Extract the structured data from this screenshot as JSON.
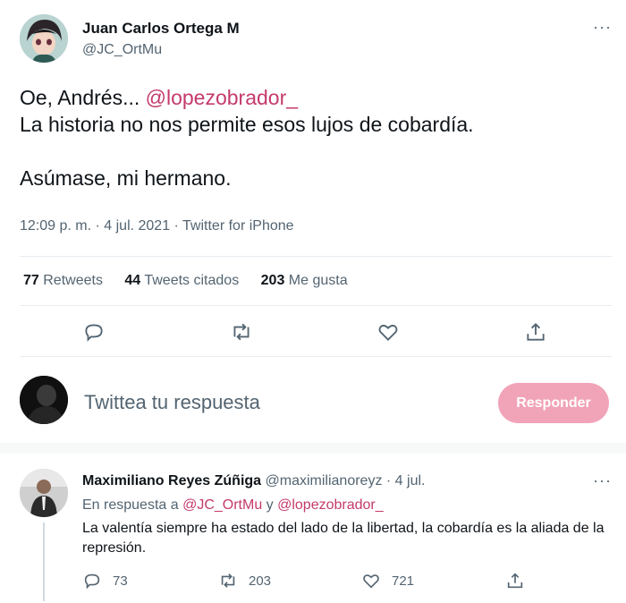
{
  "tweet": {
    "author_name": "Juan Carlos Ortega M",
    "author_handle": "@JC_OrtMu",
    "text_line1_prefix": "Oe, Andrés... ",
    "text_line1_mention": "@lopezobrador_",
    "text_line2": "La historia no nos permite esos lujos de cobardía.",
    "text_line3": "Asúmase, mi hermano.",
    "timestamp": "12:09 p. m. · 4 jul. 2021 · Twitter for iPhone",
    "stats": {
      "retweets_count": "77",
      "retweets_label": "Retweets",
      "quotes_count": "44",
      "quotes_label": "Tweets citados",
      "likes_count": "203",
      "likes_label": "Me gusta"
    }
  },
  "reply_box": {
    "placeholder": "Twittea tu respuesta",
    "button_label": "Responder"
  },
  "reply": {
    "author_name": "Maximiliano Reyes Zúñiga",
    "author_handle": "@maximilianoreyz",
    "date": "· 4 jul.",
    "in_reply_prefix": "En respuesta a ",
    "in_reply_user1": "@JC_OrtMu",
    "in_reply_and": " y ",
    "in_reply_user2": "@lopezobrador_",
    "text": "La valentía siempre ha estado del lado de la libertad, la cobardía es la aliada de la represión.",
    "reply_count": "73",
    "retweet_count": "203",
    "like_count": "721"
  },
  "icons": {
    "more": "more-horizontal-icon",
    "reply": "speech-bubble-icon",
    "retweet": "retweet-arrows-icon",
    "like": "heart-icon",
    "share": "share-upload-icon"
  },
  "colors": {
    "mention": "#c43a6c",
    "respond_button": "#f1a3b8",
    "muted_text": "#536471"
  },
  "more_glyph": "···"
}
